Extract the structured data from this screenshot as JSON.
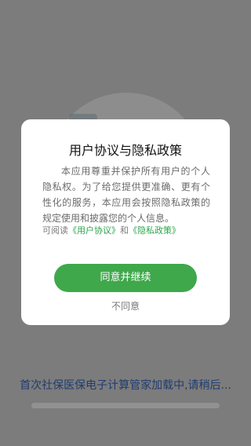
{
  "colors": {
    "overlay": "#7c7c7c",
    "accent": "#3fa84b",
    "link": "#2ea44f",
    "loading_text": "#1f3c70",
    "dialog_background": "#ffffff"
  },
  "splash": {
    "loading_text": "首次社保医保电子计算管家加载中,请稍后..."
  },
  "dialog": {
    "title": "用户协议与隐私政策",
    "body": "本应用尊重并保护所有用户的个人隐私权。为了给您提供更准确、更有个性化的服务，本应用会按照隐私政策的规定使用和披露您的个人信息。",
    "links_prefix": "可阅读",
    "user_agreement_link": "《用户协议》",
    "links_connector": "和",
    "privacy_policy_link": "《隐私政策》",
    "agree_button": "同意并继续",
    "disagree_button": "不同意"
  }
}
